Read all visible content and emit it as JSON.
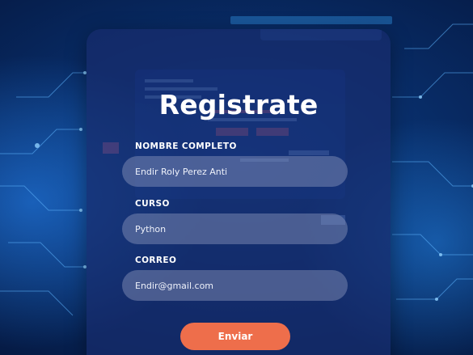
{
  "form": {
    "title": "Registrate",
    "fields": [
      {
        "label": "NOMBRE COMPLETO",
        "value": "Endir Roly Perez Anti"
      },
      {
        "label": "CURSO",
        "value": "Python"
      },
      {
        "label": "CORREO",
        "value": "Endir@gmail.com"
      }
    ],
    "submit_label": "Enviar"
  },
  "colors": {
    "background": "#082a63",
    "card": "#182c6e",
    "accent_button": "#ee6e4b",
    "text": "#ffffff"
  }
}
